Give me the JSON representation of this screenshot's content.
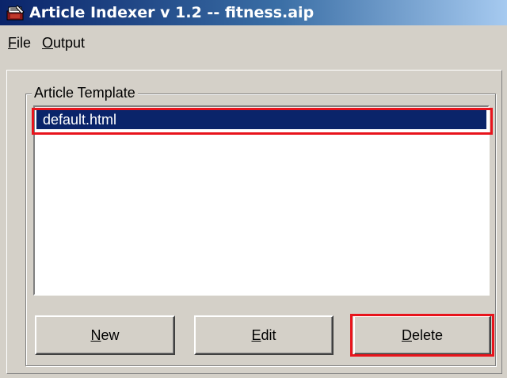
{
  "window": {
    "title": "Article Indexer v 1.2  --  fitness.aip",
    "icon": "app-icon"
  },
  "menu": {
    "file": {
      "accel": "F",
      "rest": "ile"
    },
    "output": {
      "accel": "O",
      "rest": "utput"
    }
  },
  "template_group": {
    "label": "Article Template",
    "items": [
      {
        "label": "default.html",
        "selected": true
      }
    ]
  },
  "buttons": {
    "new": {
      "accel": "N",
      "rest": "ew"
    },
    "edit": {
      "accel": "E",
      "rest": "dit"
    },
    "delete": {
      "accel": "D",
      "rest": "elete"
    }
  },
  "colors": {
    "selection": "#0a246a",
    "highlight_box": "#e8141c",
    "face": "#d4d0c8"
  }
}
